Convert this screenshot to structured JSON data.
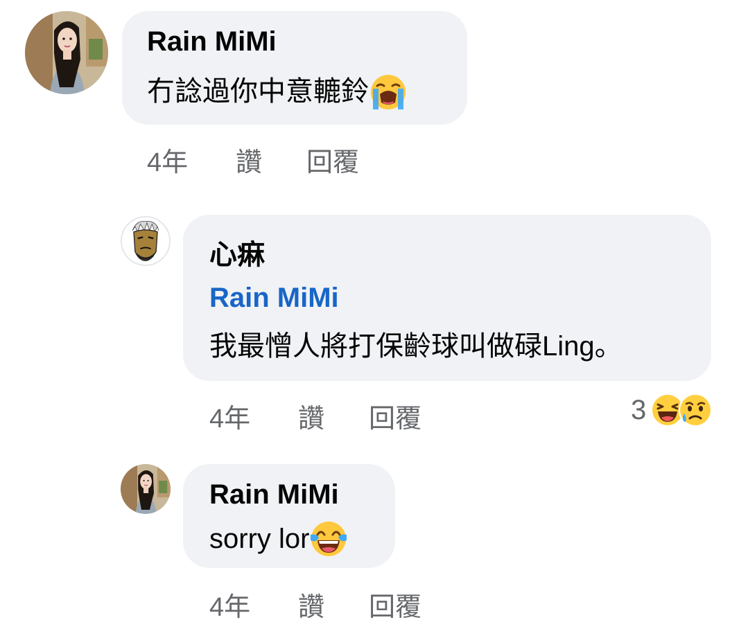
{
  "comments": [
    {
      "author": "Rain MiMi",
      "text": "冇諗過你中意轆鈴",
      "emoji": "loudly-crying-face-icon",
      "time": "4年",
      "like_label": "讚",
      "reply_label": "回覆"
    },
    {
      "author": "心痳",
      "mention": "Rain MiMi",
      "text": "我最憎人將打保齡球叫做碌Ling。",
      "time": "4年",
      "like_label": "讚",
      "reply_label": "回覆",
      "reaction_count": "3",
      "reactions": [
        "haha-reaction-icon",
        "sad-reaction-icon"
      ]
    },
    {
      "author": "Rain MiMi",
      "text": "sorry lor",
      "emoji": "tears-of-joy-face-icon",
      "time": "4年",
      "like_label": "讚",
      "reply_label": "回覆"
    }
  ],
  "colors": {
    "bubble": "#f0f2f5",
    "mention": "#1866c7",
    "meta": "#65676b",
    "text": "#050505"
  }
}
